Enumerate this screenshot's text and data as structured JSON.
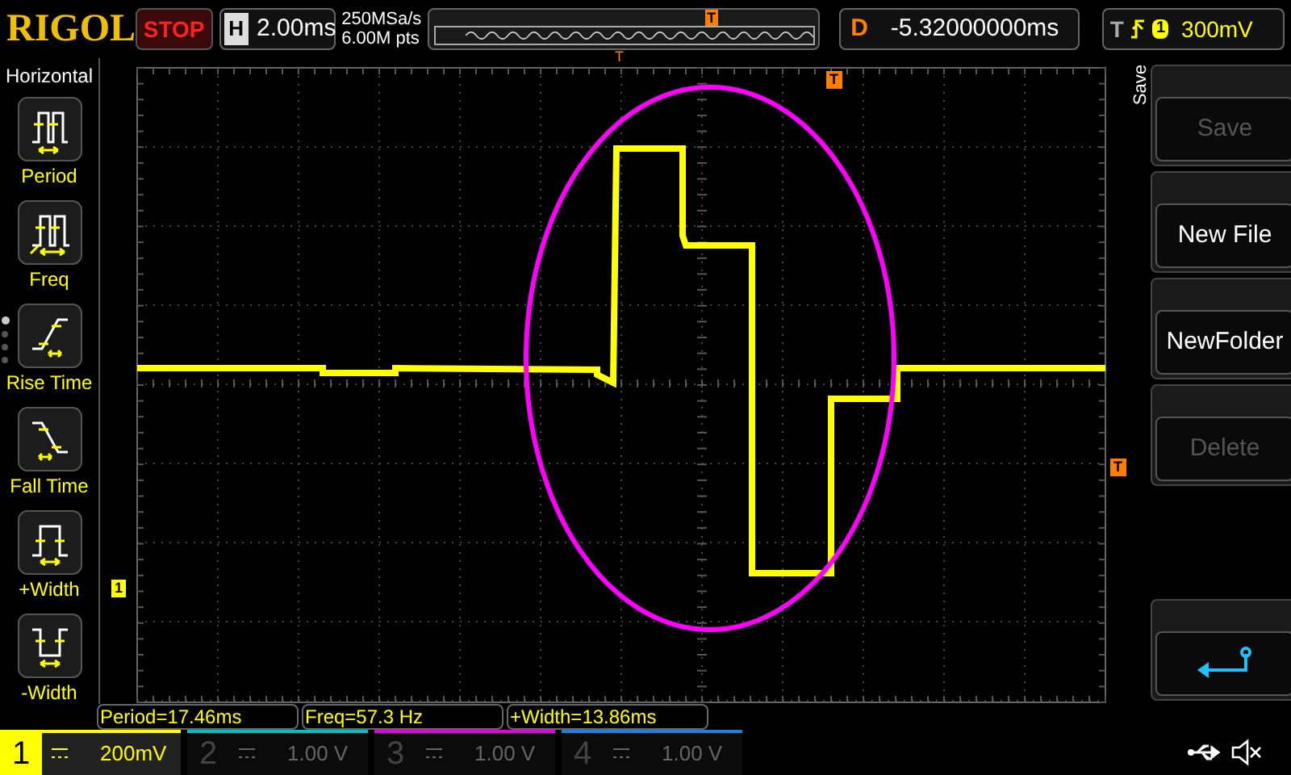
{
  "top_bar": {
    "logo": "RIGOL",
    "run_state": "STOP",
    "horizontal": {
      "label": "H",
      "value": "2.00ms"
    },
    "sample_rate": "250MSa/s",
    "memory_depth": "6.00M pts",
    "memory_bar": {
      "trigger_label": "T"
    },
    "delay": {
      "label": "D",
      "value": "-5.32000000ms"
    },
    "trigger": {
      "label": "T",
      "source": "1",
      "level": "300mV"
    }
  },
  "left_menu": {
    "title": "Horizontal",
    "page_dots": [
      {
        "selected": true
      },
      {
        "selected": false
      },
      {
        "selected": false
      },
      {
        "selected": false
      }
    ],
    "items": [
      {
        "kind": "period",
        "label": "Period"
      },
      {
        "kind": "freq",
        "label": "Freq"
      },
      {
        "kind": "rise",
        "label": "Rise Time"
      },
      {
        "kind": "fall",
        "label": "Fall Time"
      },
      {
        "kind": "pwidth",
        "label": "+Width"
      },
      {
        "kind": "nwidth",
        "label": "-Width"
      }
    ]
  },
  "grid": {
    "trigger_position_label": "T",
    "trigger_offset_label": "T",
    "trigger_level_label": "T",
    "channel_marker_label": "1"
  },
  "measurements": [
    "Period=17.46ms",
    "Freq=57.3 Hz",
    "+Width=13.86ms"
  ],
  "right_menu": {
    "title": "Save",
    "softkeys": [
      {
        "kind": "text",
        "label": "Save",
        "disabled": true
      },
      {
        "kind": "text",
        "label": "New File",
        "disabled": false
      },
      {
        "kind": "text",
        "label": "NewFolder",
        "disabled": false
      },
      {
        "kind": "text",
        "label": "Delete",
        "disabled": true
      },
      {
        "kind": "spacer"
      },
      {
        "kind": "return",
        "disabled": false
      }
    ]
  },
  "channels": [
    {
      "number": "1",
      "scale": "200mV",
      "selected": true,
      "color": "#ffff00"
    },
    {
      "number": "2",
      "scale": "1.00 V",
      "selected": false,
      "color": "#00c0c0"
    },
    {
      "number": "3",
      "scale": "1.00 V",
      "selected": false,
      "color": "#e000e0"
    },
    {
      "number": "4",
      "scale": "1.00 V",
      "selected": false,
      "color": "#2080e0"
    }
  ]
}
